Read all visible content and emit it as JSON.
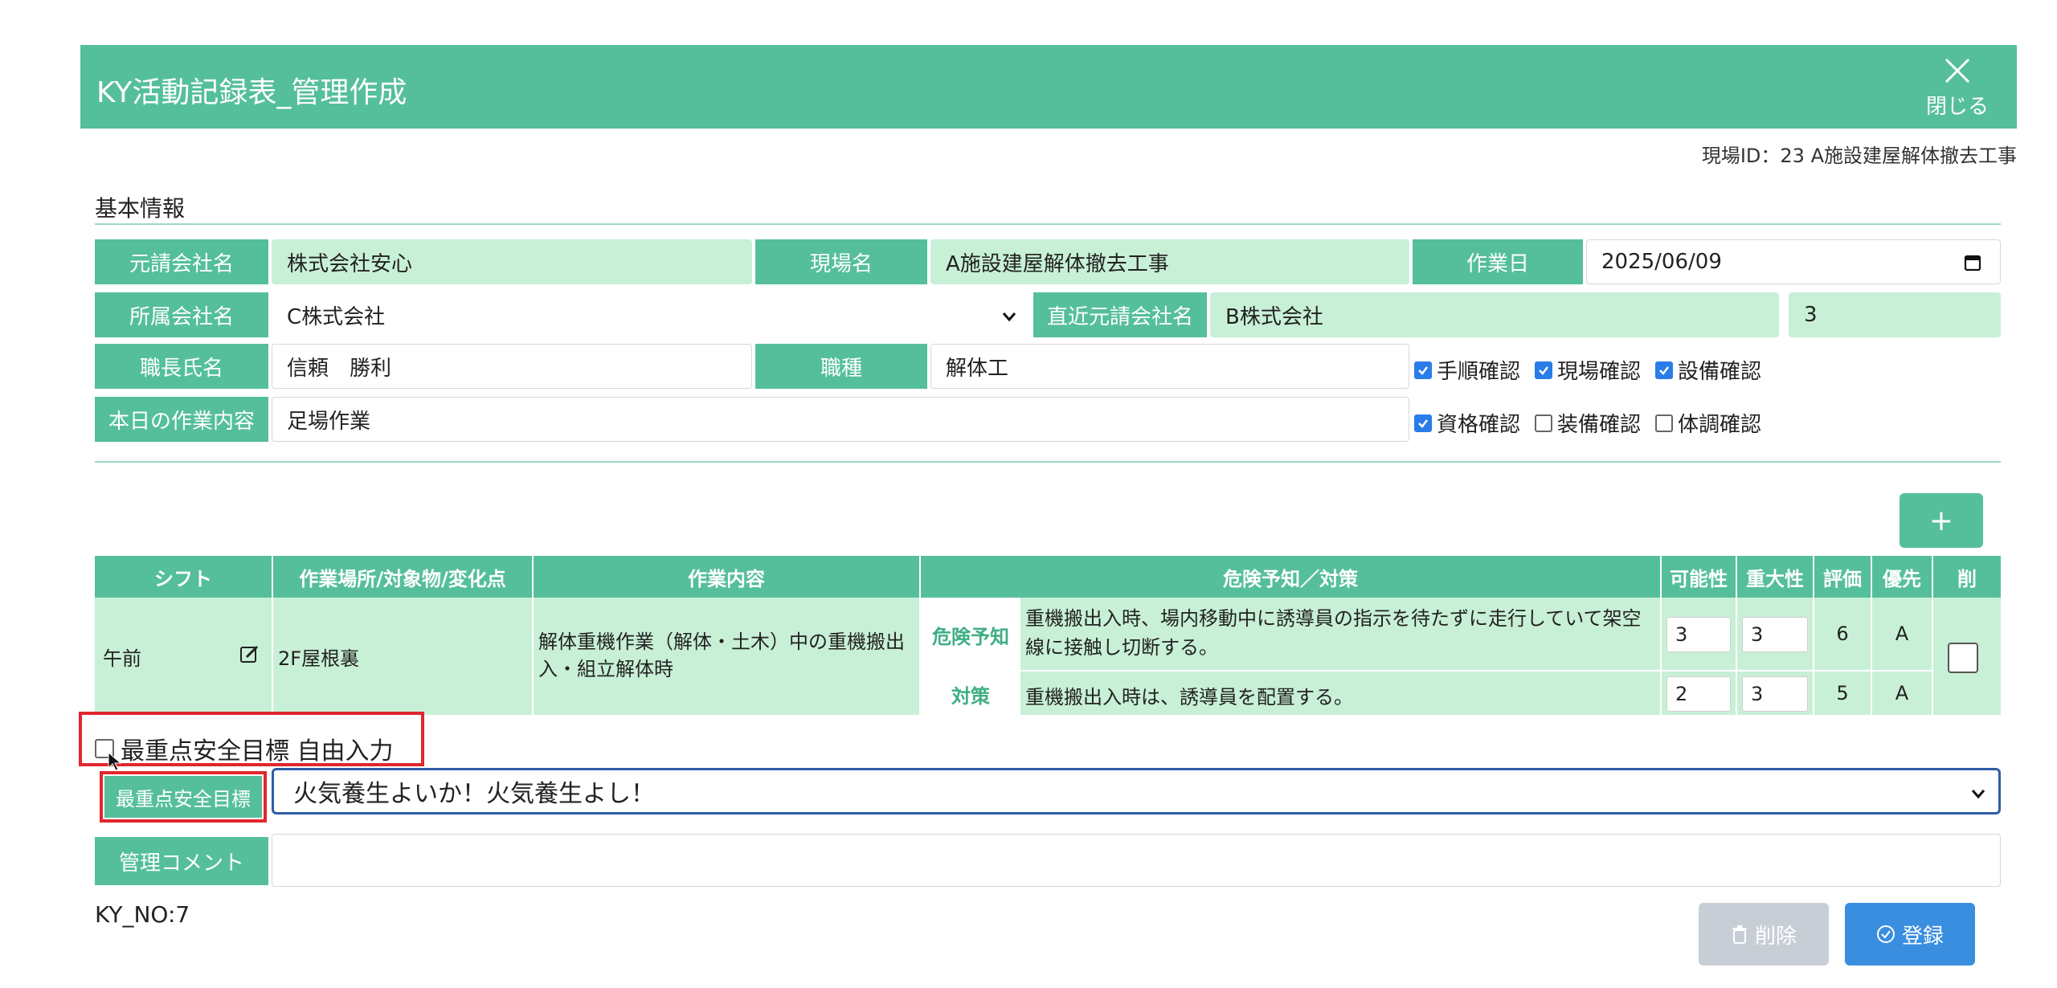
{
  "header": {
    "title": "KY活動記録表_管理作成",
    "close_label": "閉じる"
  },
  "site_id_text": "現場ID：23 A施設建屋解体撤去工事",
  "basic_info": {
    "section_title": "基本情報",
    "prime_contractor_label": "元請会社名",
    "prime_contractor_value": "株式会社安心",
    "site_name_label": "現場名",
    "site_name_value": "A施設建屋解体撤去工事",
    "work_date_label": "作業日",
    "work_date_value": "2025/06/09",
    "affiliated_company_label": "所属会社名",
    "affiliated_company_value": "C株式会社",
    "nearest_contractor_label": "直近元請会社名",
    "nearest_contractor_value": "B株式会社",
    "nearest_contractor_extra": "3",
    "foreman_label": "職長氏名",
    "foreman_value": "信頼　勝利",
    "job_type_label": "職種",
    "job_type_value": "解体工",
    "todays_work_label": "本日の作業内容",
    "todays_work_value": "足場作業",
    "checks": [
      {
        "label": "手順確認",
        "checked": true
      },
      {
        "label": "現場確認",
        "checked": true
      },
      {
        "label": "設備確認",
        "checked": true
      },
      {
        "label": "資格確認",
        "checked": true
      },
      {
        "label": "装備確認",
        "checked": false
      },
      {
        "label": "体調確認",
        "checked": false
      }
    ]
  },
  "add_button_label": "+",
  "risk_table": {
    "headers": {
      "shift": "シフト",
      "place": "作業場所/対象物/変化点",
      "work": "作業内容",
      "hazard": "危険予知／対策",
      "likelihood": "可能性",
      "severity": "重大性",
      "score": "評価",
      "priority": "優先",
      "delete": "削"
    },
    "row": {
      "shift": "午前",
      "place": "2F屋根裏",
      "work": "解体重機作業（解体・土木）中の重機搬出入・組立解体時",
      "hazard_tag": "危険予知",
      "hazard_text": "重機搬出入時、場内移動中に誘導員の指示を待たずに走行していて架空線に接触し切断する。",
      "hazard_likelihood": "3",
      "hazard_severity": "3",
      "hazard_score": "6",
      "hazard_priority": "A",
      "measure_tag": "対策",
      "measure_text": "重機搬出入時は、誘導員を配置する。",
      "measure_likelihood": "2",
      "measure_severity": "3",
      "measure_score": "5",
      "measure_priority": "A"
    }
  },
  "goal": {
    "free_input_label": "最重点安全目標 自由入力",
    "free_input_checked": false,
    "goal_label": "最重点安全目標",
    "goal_value": "火気養生よいか！火気養生よし！"
  },
  "comment": {
    "label": "管理コメント",
    "value": ""
  },
  "footer": {
    "ky_no": "KY_NO:7",
    "delete_label": "削除",
    "save_label": "登録"
  },
  "colors": {
    "accent": "#55bf9b",
    "readonly_bg": "#c8f0d6",
    "highlight_red": "#e0262e",
    "save_blue": "#3a8ee0"
  }
}
